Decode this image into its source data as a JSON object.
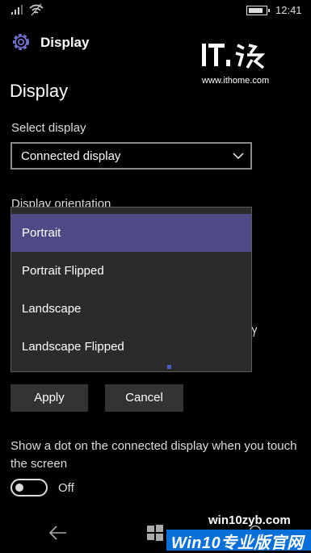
{
  "status_bar": {
    "time": "12:41",
    "battery_level": 0.72
  },
  "header": {
    "title": "Display"
  },
  "watermark": {
    "logo_text": "IT之家",
    "url": "www.ithome.com",
    "bottom_site": "win10zyb.com",
    "bottom_banner": "Win10专业版官网"
  },
  "page": {
    "title": "Display"
  },
  "select_display": {
    "label": "Select display",
    "value": "Connected display"
  },
  "orientation": {
    "label": "Display orientation",
    "options": [
      "Portrait",
      "Portrait Flipped",
      "Landscape",
      "Landscape Flipped"
    ],
    "selected_index": 0
  },
  "buttons": {
    "apply": "Apply",
    "cancel": "Cancel"
  },
  "touch_dot": {
    "description": "Show a dot on the connected display when you touch the screen",
    "toggle_state": "Off"
  },
  "colors": {
    "accent": "#4e4a86",
    "highlight_blue": "#4a5ec9",
    "banner": "#0a6fd8"
  }
}
